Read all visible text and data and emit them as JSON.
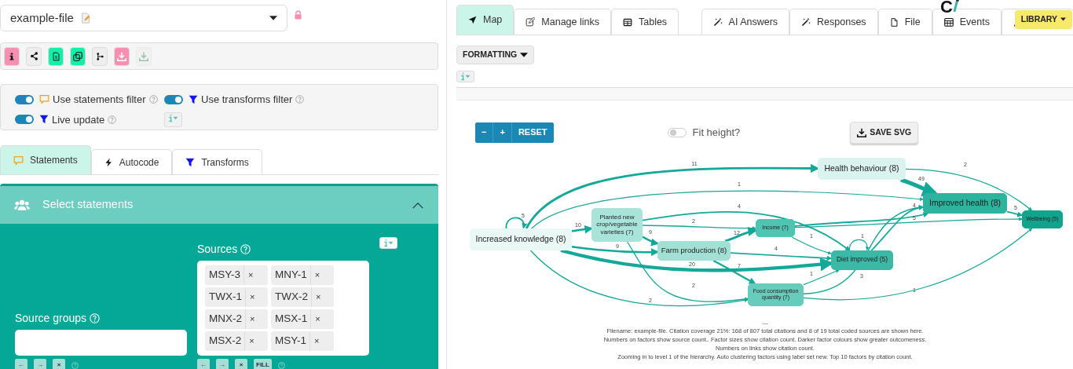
{
  "file_select": {
    "value": "example-file",
    "locked": true
  },
  "toolbar": [
    {
      "kind": "info",
      "color": "#f78fb3",
      "disabled": false
    },
    {
      "kind": "share",
      "color": "#eeeeee",
      "disabled": false
    },
    {
      "kind": "document",
      "color": "#14f0a8",
      "disabled": false
    },
    {
      "kind": "copy",
      "color": "#14f0a8",
      "disabled": false
    },
    {
      "kind": "branch",
      "color": "#eeeeee",
      "disabled": false
    },
    {
      "kind": "download",
      "color": "#f78fb3",
      "disabled": false
    },
    {
      "kind": "download",
      "color": "#eeeeee",
      "disabled": true
    }
  ],
  "filters": [
    {
      "label": "Use statements filter",
      "kind": "speech",
      "on": true
    },
    {
      "label": "Use transforms filter",
      "kind": "funnel",
      "on": true
    },
    {
      "label": "Live update",
      "kind": "funnel",
      "on": true
    }
  ],
  "left_tabs": [
    {
      "label": "Statements",
      "kind": "speech",
      "selected": true
    },
    {
      "label": "Autocode",
      "kind": "bolt",
      "selected": false
    },
    {
      "label": "Transforms",
      "kind": "funnel",
      "selected": false
    }
  ],
  "statements_panel": {
    "title": "Select statements",
    "expanded": true,
    "source_groups": {
      "label": "Source groups",
      "buttons": [
        "←",
        "→",
        "×"
      ]
    },
    "sources": {
      "label": "Sources",
      "tags": [
        {
          "name": "MSY-3",
          "remove": "×"
        },
        {
          "name": "MNY-1",
          "remove": "×"
        },
        {
          "name": "TWX-1",
          "remove": "×"
        },
        {
          "name": "TWX-2",
          "remove": "×"
        },
        {
          "name": "MNX-2",
          "remove": "×"
        },
        {
          "name": "MSX-1",
          "remove": "×"
        },
        {
          "name": "MSX-2",
          "remove": "×"
        },
        {
          "name": "MSY-1",
          "remove": "×"
        }
      ],
      "buttons": [
        "←",
        "→",
        "×",
        "FILL"
      ]
    }
  },
  "map_tabs": [
    {
      "label": "Map",
      "kind": "navigate",
      "selected": true
    },
    {
      "label": "Manage links",
      "kind": "edit",
      "selected": false
    },
    {
      "label": "Tables",
      "kind": "table",
      "selected": false
    }
  ],
  "panel_tabs": [
    {
      "label": "AI Answers",
      "kind": "wand",
      "selected": false
    },
    {
      "label": "Responses",
      "kind": "wand",
      "selected": false
    },
    {
      "label": "File",
      "kind": "file",
      "selected": false
    },
    {
      "label": "Events",
      "kind": "calendar",
      "selected": false
    },
    {
      "kind": "user",
      "selected": false
    }
  ],
  "logo": {
    "letter": "C"
  },
  "library_button": "LIBRARY",
  "formatting_button": "FORMATTING",
  "zoom_controls": [
    "−",
    "+",
    "RESET"
  ],
  "fit_height": {
    "label": "Fit height?",
    "on": false
  },
  "save_button": "SAVE SVG",
  "map": {
    "nodes": [
      {
        "label": "Increased knowledge (8)",
        "color": "#eaf8f5"
      },
      {
        "label": "Planted new crop/vegetable varieties (7)",
        "color": "#a9e4da"
      },
      {
        "label": "Farm production (8)",
        "color": "#a2e0d5"
      },
      {
        "label": "Income (7)",
        "color": "#4ec4b1"
      },
      {
        "label": "Diet improved (5)",
        "color": "#3bb9a6"
      },
      {
        "label": "Food consumption quantity (7)",
        "color": "#68ccbc"
      },
      {
        "label": "Health behaviour (8)",
        "color": "#dbf3ef"
      },
      {
        "label": "Improved health (8)",
        "color": "#2db39e"
      },
      {
        "label": "Wellbeing (5)",
        "color": "#10a48d"
      }
    ],
    "edges": [
      {
        "label": "11"
      },
      {
        "label": "1"
      },
      {
        "label": "5"
      },
      {
        "label": "10"
      },
      {
        "label": "9"
      },
      {
        "label": "20"
      },
      {
        "label": "2"
      },
      {
        "label": "4"
      },
      {
        "label": "2"
      },
      {
        "label": "9"
      },
      {
        "label": "2"
      },
      {
        "label": "12"
      },
      {
        "label": "4"
      },
      {
        "label": "7"
      },
      {
        "label": "1"
      },
      {
        "label": "1"
      },
      {
        "label": "4"
      },
      {
        "label": "1"
      },
      {
        "label": "3"
      },
      {
        "label": "5"
      },
      {
        "label": "1"
      },
      {
        "label": "49"
      },
      {
        "label": "2"
      },
      {
        "label": "5"
      }
    ]
  },
  "caption": {
    "separator": "---",
    "lines": [
      "Filename: example-file. Citation coverage 21%: 168 of 807 total citations and 8 of 19 total coded sources are shown here.",
      "Numbers on factors show source count.. Factor sizes show citation count. Darker factor colours show greater outcomeness.",
      "Numbers on links show citation count.",
      "Zooming in to level 1 of the hierarchy. Auto clustering factors using label set new. Top 10 factors by citation count."
    ]
  }
}
